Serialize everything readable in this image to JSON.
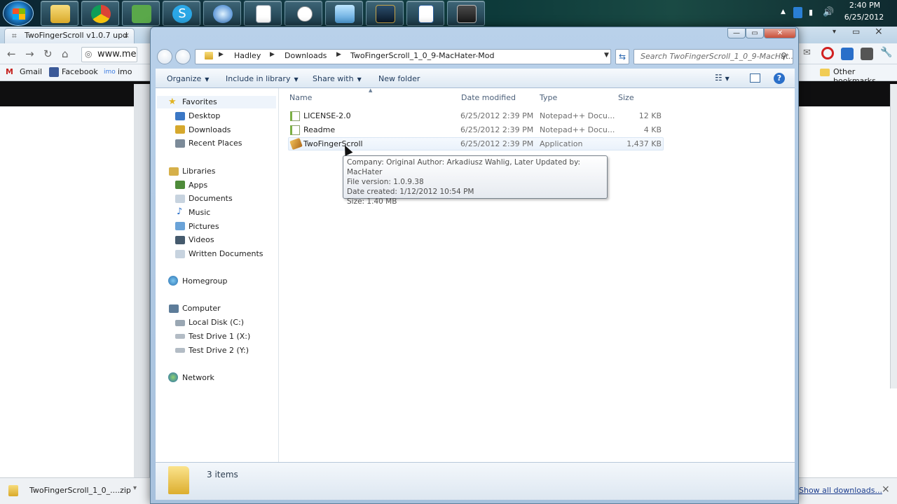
{
  "taskbar": {
    "clock_time": "2:40 PM",
    "clock_date": "6/25/2012",
    "pinned": [
      "explorer-folder",
      "chrome",
      "evernote",
      "skype",
      "itunes",
      "document",
      "clock",
      "control-panel",
      "league",
      "word-doc",
      "monitor"
    ]
  },
  "browser": {
    "tab_title": "TwoFingerScroll v1.0.7 upd",
    "url": "www.me",
    "bookmarks": {
      "gmail": "Gmail",
      "facebook": "Facebook",
      "imo": "imo",
      "other": "Other bookmarks"
    },
    "download_file": "TwoFingerScroll_1_0_....zip",
    "show_all_downloads": "Show all downloads..."
  },
  "explorer": {
    "breadcrumb": [
      "Hadley",
      "Downloads",
      "TwoFingerScroll_1_0_9-MacHater-Mod"
    ],
    "search_placeholder": "Search TwoFingerScroll_1_0_9-MacHat...",
    "commands": {
      "organize": "Organize",
      "include": "Include in library",
      "share": "Share with",
      "new_folder": "New folder"
    },
    "nav": {
      "favorites": "Favorites",
      "desktop": "Desktop",
      "downloads": "Downloads",
      "recent": "Recent Places",
      "libraries": "Libraries",
      "apps": "Apps",
      "documents": "Documents",
      "music": "Music",
      "pictures": "Pictures",
      "videos": "Videos",
      "written": "Written Documents",
      "homegroup": "Homegroup",
      "computer": "Computer",
      "local_disk": "Local Disk (C:)",
      "test1": "Test Drive 1 (X:)",
      "test2": "Test Drive 2 (Y:)",
      "network": "Network"
    },
    "columns": {
      "name": "Name",
      "date": "Date modified",
      "type": "Type",
      "size": "Size"
    },
    "files": [
      {
        "name": "LICENSE-2.0",
        "date": "6/25/2012 2:39 PM",
        "type": "Notepad++ Docu...",
        "size": "12 KB"
      },
      {
        "name": "Readme",
        "date": "6/25/2012 2:39 PM",
        "type": "Notepad++ Docu...",
        "size": "4 KB"
      },
      {
        "name": "TwoFingerScroll",
        "date": "6/25/2012 2:39 PM",
        "type": "Application",
        "size": "1,437 KB"
      }
    ],
    "tooltip": {
      "company": "Company: Original Author: Arkadiusz Wahlig, Later Updated by: MacHater",
      "version": "File version: 1.0.9.38",
      "created": "Date created: 1/12/2012 10:54 PM",
      "size": "Size: 1.40 MB"
    },
    "status": "3 items"
  }
}
